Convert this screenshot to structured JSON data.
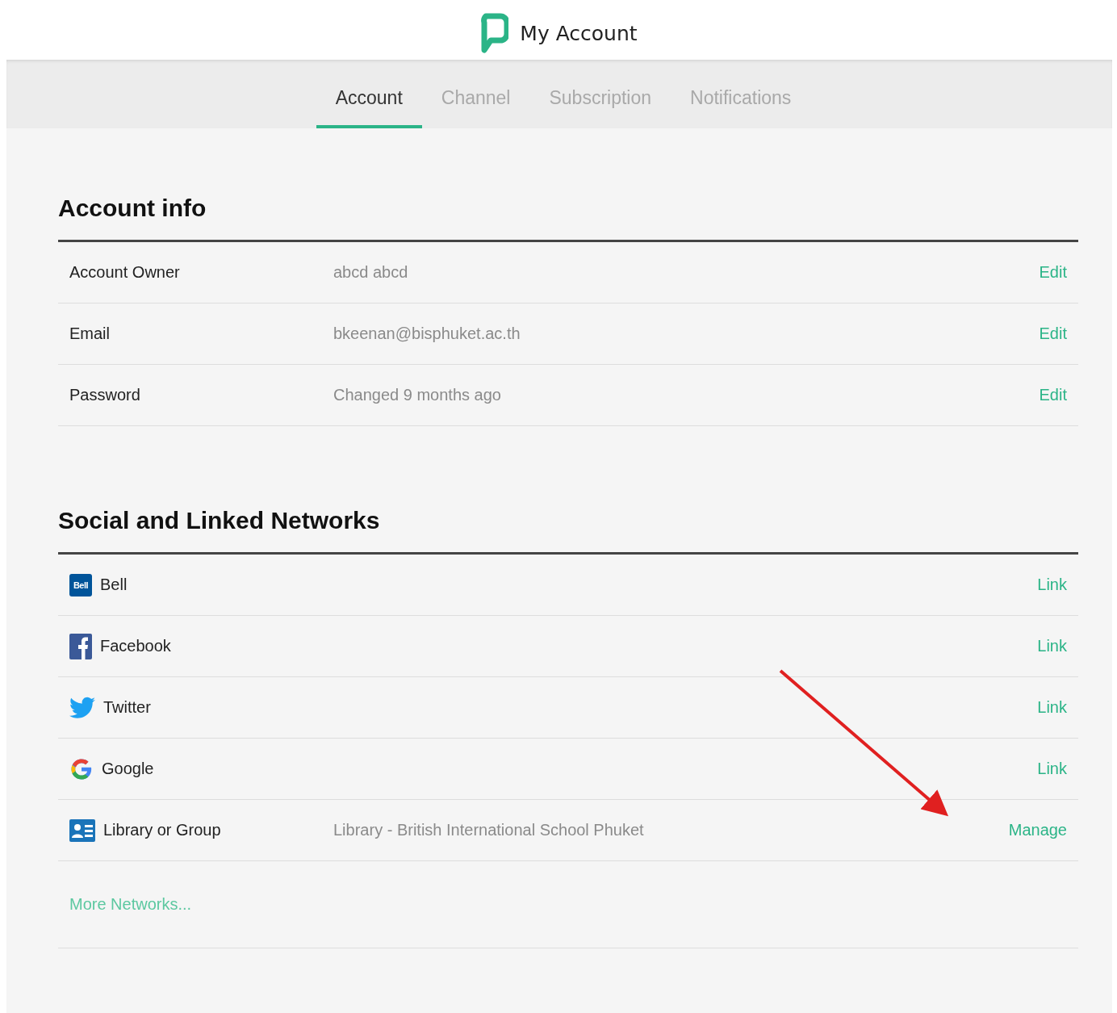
{
  "header": {
    "title": "My Account"
  },
  "tabs": [
    {
      "label": "Account",
      "selected": true
    },
    {
      "label": "Channel",
      "selected": false
    },
    {
      "label": "Subscription",
      "selected": false
    },
    {
      "label": "Notifications",
      "selected": false
    }
  ],
  "account_info": {
    "heading": "Account info",
    "rows": [
      {
        "label": "Account Owner",
        "value": "abcd abcd",
        "action": "Edit"
      },
      {
        "label": "Email",
        "value": "bkeenan@bisphuket.ac.th",
        "action": "Edit"
      },
      {
        "label": "Password",
        "value": "Changed 9 months ago",
        "action": "Edit"
      }
    ]
  },
  "networks": {
    "heading": "Social and Linked Networks",
    "rows": [
      {
        "kind": "bell",
        "icon_text": "Bell",
        "name": "Bell",
        "action": "Link"
      },
      {
        "kind": "facebook",
        "name": "Facebook",
        "action": "Link"
      },
      {
        "kind": "twitter",
        "name": "Twitter",
        "action": "Link"
      },
      {
        "kind": "google",
        "name": "Google",
        "action": "Link"
      },
      {
        "kind": "library",
        "name": "Library or Group",
        "value": "Library - British International School Phuket",
        "action": "Manage"
      }
    ],
    "more_link": "More Networks..."
  },
  "annotations": [
    {
      "kind": "arrow"
    }
  ]
}
